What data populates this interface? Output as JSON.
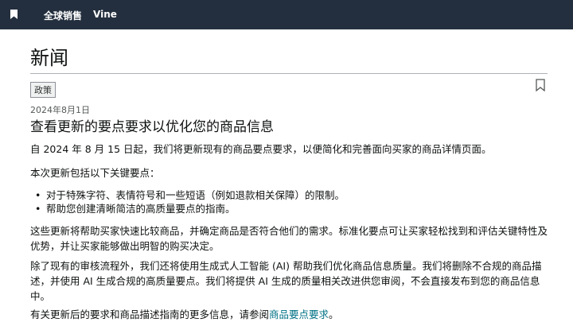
{
  "header": {
    "nav": [
      "全球销售",
      "Vine"
    ]
  },
  "page": {
    "title": "新闻"
  },
  "article": {
    "tag": "政策",
    "date": "2024年8月1日",
    "title": "查看更新的要点要求以优化您的商品信息",
    "intro": "自 2024 年 8 月 15 日起，我们将更新现有的商品要点要求，以便简化和完善面向买家的商品详情页面。",
    "list_intro": "本次更新包括以下关键要点：",
    "bullets": [
      "对于特殊字符、表情符号和一些短语（例如退款相关保障）的限制。",
      "帮助您创建清晰简洁的高质量要点的指南。"
    ],
    "para2": "这些更新将帮助买家快速比较商品，并确定商品是否符合他们的需求。标准化要点可让买家轻松找到和评估关键特性及优势，并让买家能够做出明智的购买决定。",
    "para3": "除了现有的审核流程外，我们还将使用生成式人工智能 (AI) 帮助我们优化商品信息质量。我们将删除不合规的商品描述，并使用 AI 生成合规的高质量要点。我们将提供 AI 生成的质量相关改进供您审阅，不会直接发布到您的商品信息中。",
    "footer_text": "有关更新后的要求和商品描述指南的更多信息，请参阅",
    "footer_link": "商品要点要求",
    "footer_end": "。"
  },
  "icons": {
    "logo": "bookmark-logo-icon",
    "bookmark": "bookmark-icon"
  },
  "colors": {
    "header_bg": "#232f3e",
    "link": "#007185"
  }
}
